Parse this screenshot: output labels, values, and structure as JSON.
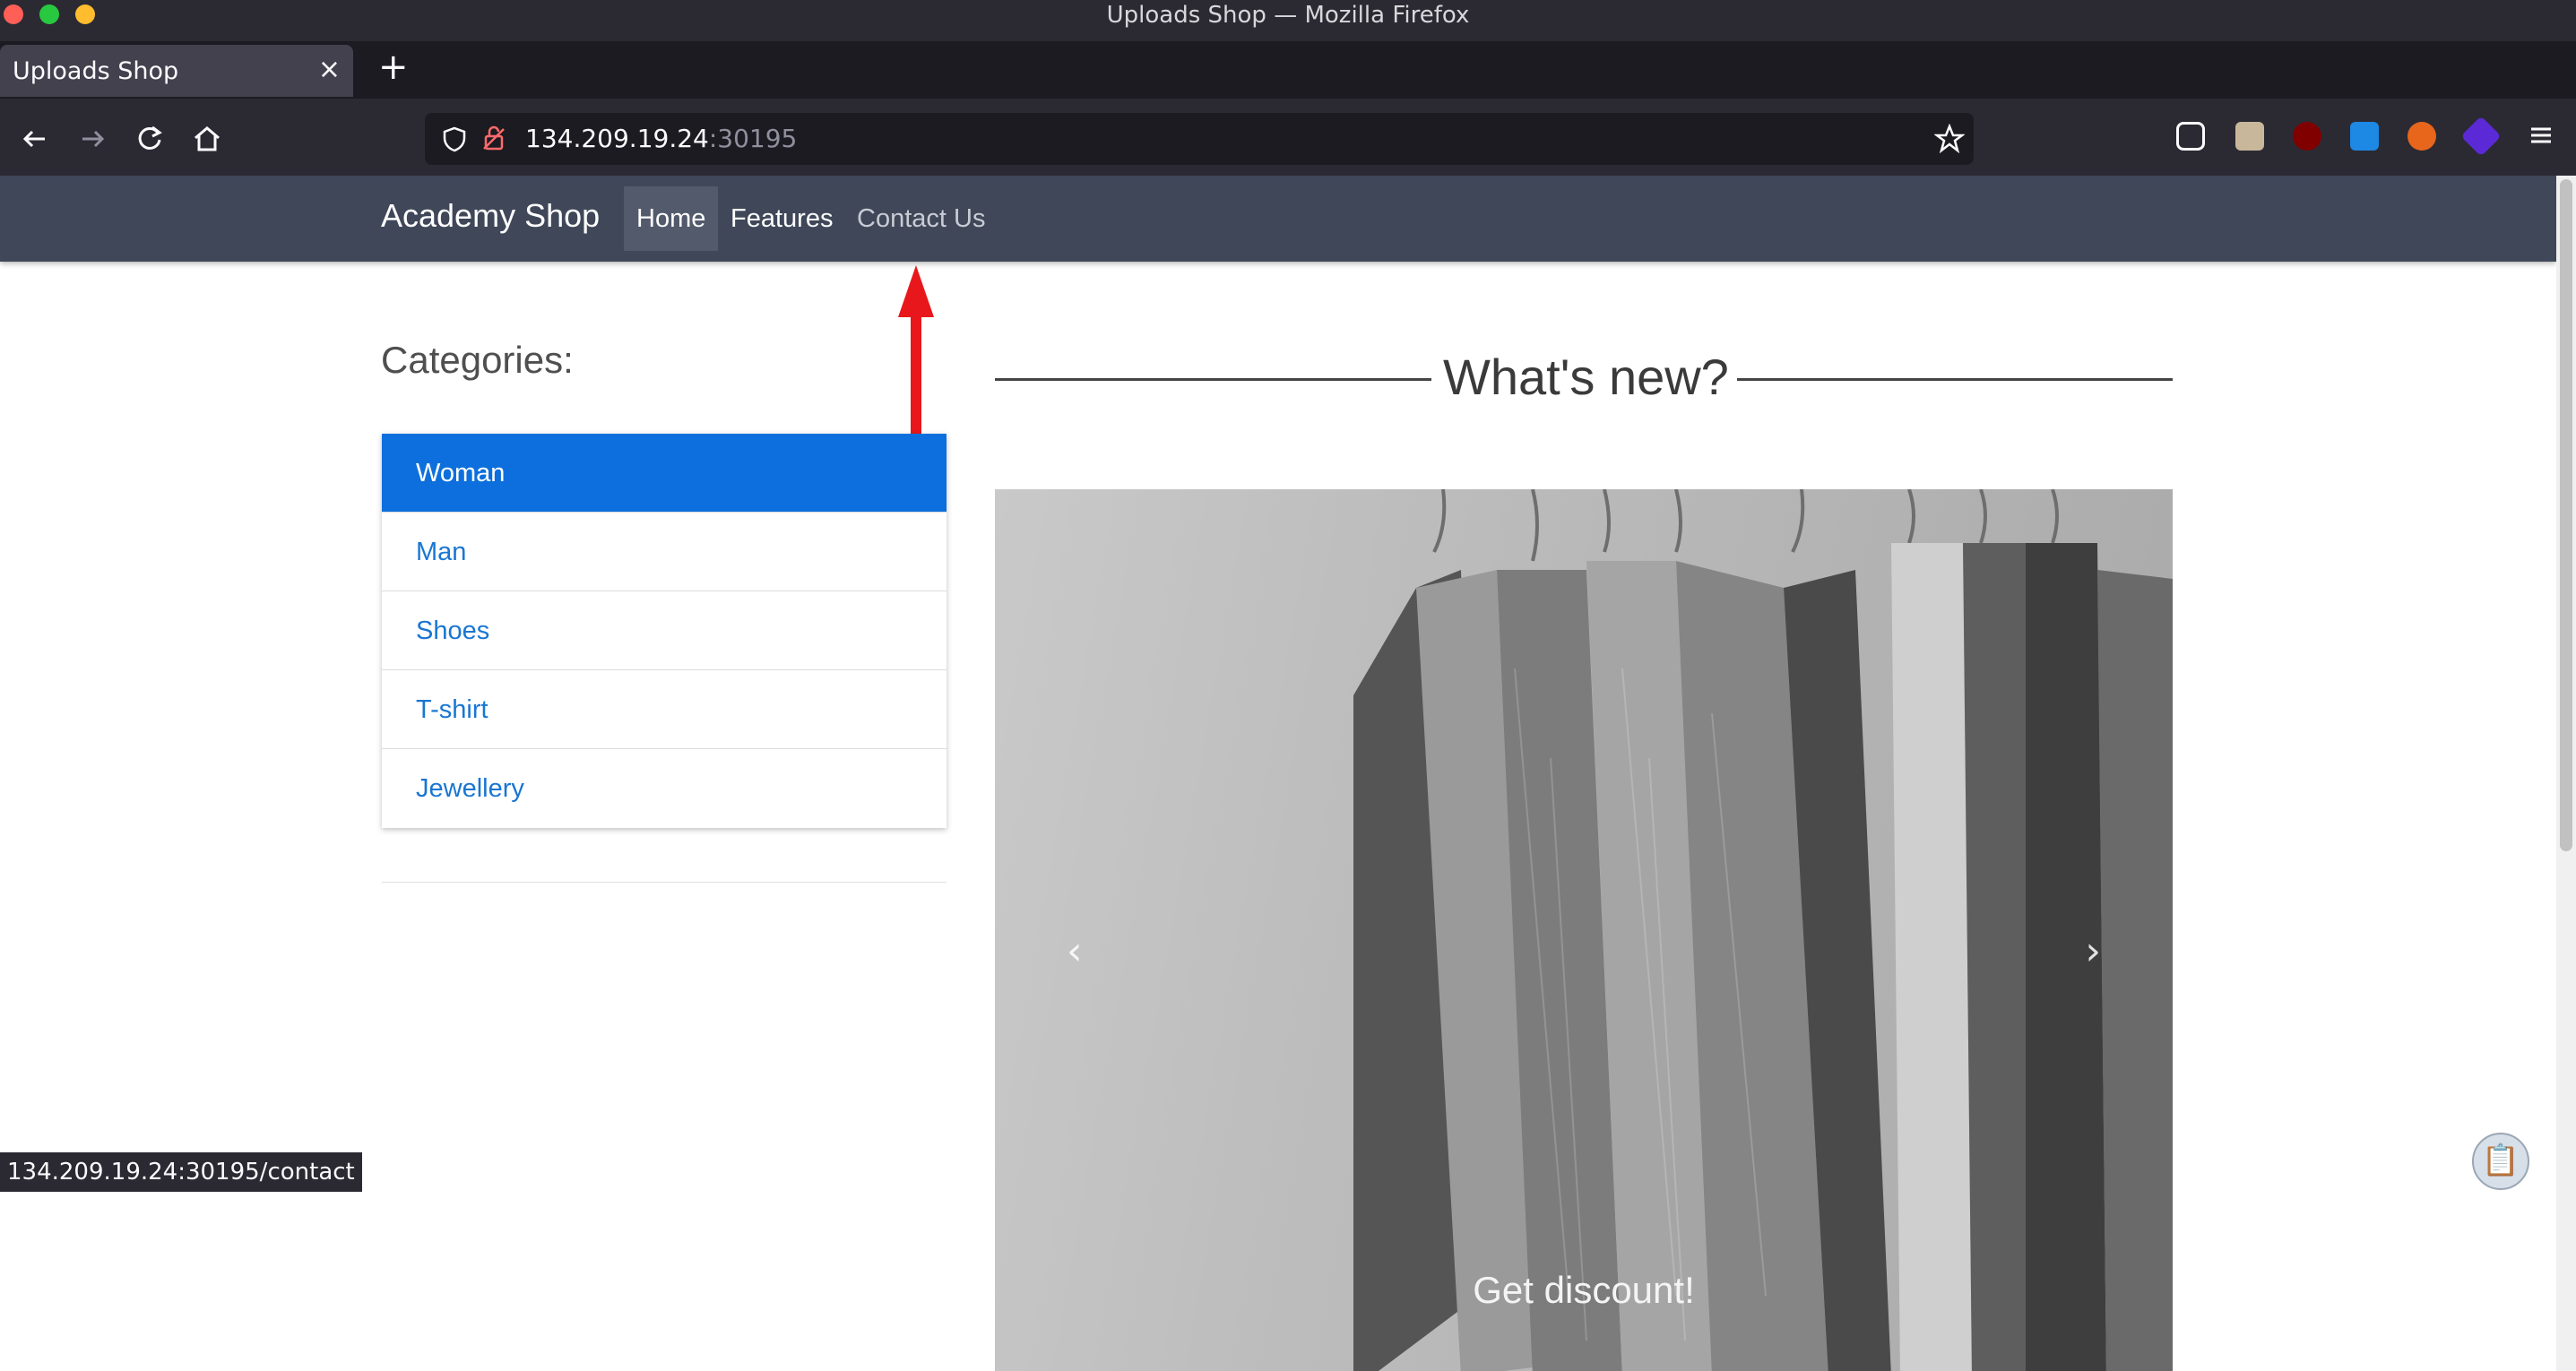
{
  "window": {
    "title": "Uploads Shop — Mozilla Firefox"
  },
  "tab": {
    "title": "Uploads Shop",
    "close_glyph": "×",
    "new_tab_glyph": "+"
  },
  "toolbar": {
    "url_host": "134.209.19.24",
    "url_port": ":30195",
    "back_icon": "arrow-left-icon",
    "forward_icon": "arrow-right-icon",
    "reload_icon": "reload-icon",
    "home_icon": "home-icon"
  },
  "site": {
    "brand": "Academy Shop",
    "nav": {
      "home": "Home",
      "features": "Features",
      "contact": "Contact Us"
    }
  },
  "sidebar": {
    "title": "Categories:",
    "items": [
      {
        "label": "Woman",
        "active": true
      },
      {
        "label": "Man"
      },
      {
        "label": "Shoes"
      },
      {
        "label": "T-shirt"
      },
      {
        "label": "Jewellery"
      }
    ]
  },
  "main": {
    "heading": "What's new?",
    "carousel": {
      "caption": "Get discount!",
      "prev_glyph": "‹",
      "next_glyph": "›"
    }
  },
  "status_bar": {
    "link": "134.209.19.24:30195/contact"
  },
  "colors": {
    "navbar": "#3f4759",
    "active_category": "#0d6fdd",
    "category_link": "#1976d2",
    "annotation_arrow": "#e8171b"
  }
}
